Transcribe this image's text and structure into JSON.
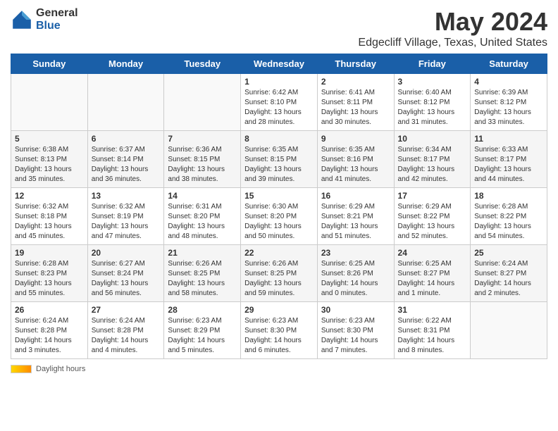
{
  "header": {
    "logo_general": "General",
    "logo_blue": "Blue",
    "title": "May 2024",
    "subtitle": "Edgecliff Village, Texas, United States"
  },
  "days_of_week": [
    "Sunday",
    "Monday",
    "Tuesday",
    "Wednesday",
    "Thursday",
    "Friday",
    "Saturday"
  ],
  "weeks": [
    [
      {
        "day": "",
        "info": ""
      },
      {
        "day": "",
        "info": ""
      },
      {
        "day": "",
        "info": ""
      },
      {
        "day": "1",
        "info": "Sunrise: 6:42 AM\nSunset: 8:10 PM\nDaylight: 13 hours and 28 minutes."
      },
      {
        "day": "2",
        "info": "Sunrise: 6:41 AM\nSunset: 8:11 PM\nDaylight: 13 hours and 30 minutes."
      },
      {
        "day": "3",
        "info": "Sunrise: 6:40 AM\nSunset: 8:12 PM\nDaylight: 13 hours and 31 minutes."
      },
      {
        "day": "4",
        "info": "Sunrise: 6:39 AM\nSunset: 8:12 PM\nDaylight: 13 hours and 33 minutes."
      }
    ],
    [
      {
        "day": "5",
        "info": "Sunrise: 6:38 AM\nSunset: 8:13 PM\nDaylight: 13 hours and 35 minutes."
      },
      {
        "day": "6",
        "info": "Sunrise: 6:37 AM\nSunset: 8:14 PM\nDaylight: 13 hours and 36 minutes."
      },
      {
        "day": "7",
        "info": "Sunrise: 6:36 AM\nSunset: 8:15 PM\nDaylight: 13 hours and 38 minutes."
      },
      {
        "day": "8",
        "info": "Sunrise: 6:35 AM\nSunset: 8:15 PM\nDaylight: 13 hours and 39 minutes."
      },
      {
        "day": "9",
        "info": "Sunrise: 6:35 AM\nSunset: 8:16 PM\nDaylight: 13 hours and 41 minutes."
      },
      {
        "day": "10",
        "info": "Sunrise: 6:34 AM\nSunset: 8:17 PM\nDaylight: 13 hours and 42 minutes."
      },
      {
        "day": "11",
        "info": "Sunrise: 6:33 AM\nSunset: 8:17 PM\nDaylight: 13 hours and 44 minutes."
      }
    ],
    [
      {
        "day": "12",
        "info": "Sunrise: 6:32 AM\nSunset: 8:18 PM\nDaylight: 13 hours and 45 minutes."
      },
      {
        "day": "13",
        "info": "Sunrise: 6:32 AM\nSunset: 8:19 PM\nDaylight: 13 hours and 47 minutes."
      },
      {
        "day": "14",
        "info": "Sunrise: 6:31 AM\nSunset: 8:20 PM\nDaylight: 13 hours and 48 minutes."
      },
      {
        "day": "15",
        "info": "Sunrise: 6:30 AM\nSunset: 8:20 PM\nDaylight: 13 hours and 50 minutes."
      },
      {
        "day": "16",
        "info": "Sunrise: 6:29 AM\nSunset: 8:21 PM\nDaylight: 13 hours and 51 minutes."
      },
      {
        "day": "17",
        "info": "Sunrise: 6:29 AM\nSunset: 8:22 PM\nDaylight: 13 hours and 52 minutes."
      },
      {
        "day": "18",
        "info": "Sunrise: 6:28 AM\nSunset: 8:22 PM\nDaylight: 13 hours and 54 minutes."
      }
    ],
    [
      {
        "day": "19",
        "info": "Sunrise: 6:28 AM\nSunset: 8:23 PM\nDaylight: 13 hours and 55 minutes."
      },
      {
        "day": "20",
        "info": "Sunrise: 6:27 AM\nSunset: 8:24 PM\nDaylight: 13 hours and 56 minutes."
      },
      {
        "day": "21",
        "info": "Sunrise: 6:26 AM\nSunset: 8:25 PM\nDaylight: 13 hours and 58 minutes."
      },
      {
        "day": "22",
        "info": "Sunrise: 6:26 AM\nSunset: 8:25 PM\nDaylight: 13 hours and 59 minutes."
      },
      {
        "day": "23",
        "info": "Sunrise: 6:25 AM\nSunset: 8:26 PM\nDaylight: 14 hours and 0 minutes."
      },
      {
        "day": "24",
        "info": "Sunrise: 6:25 AM\nSunset: 8:27 PM\nDaylight: 14 hours and 1 minute."
      },
      {
        "day": "25",
        "info": "Sunrise: 6:24 AM\nSunset: 8:27 PM\nDaylight: 14 hours and 2 minutes."
      }
    ],
    [
      {
        "day": "26",
        "info": "Sunrise: 6:24 AM\nSunset: 8:28 PM\nDaylight: 14 hours and 3 minutes."
      },
      {
        "day": "27",
        "info": "Sunrise: 6:24 AM\nSunset: 8:28 PM\nDaylight: 14 hours and 4 minutes."
      },
      {
        "day": "28",
        "info": "Sunrise: 6:23 AM\nSunset: 8:29 PM\nDaylight: 14 hours and 5 minutes."
      },
      {
        "day": "29",
        "info": "Sunrise: 6:23 AM\nSunset: 8:30 PM\nDaylight: 14 hours and 6 minutes."
      },
      {
        "day": "30",
        "info": "Sunrise: 6:23 AM\nSunset: 8:30 PM\nDaylight: 14 hours and 7 minutes."
      },
      {
        "day": "31",
        "info": "Sunrise: 6:22 AM\nSunset: 8:31 PM\nDaylight: 14 hours and 8 minutes."
      },
      {
        "day": "",
        "info": ""
      }
    ]
  ],
  "footer": {
    "legend_label": "Daylight hours"
  }
}
